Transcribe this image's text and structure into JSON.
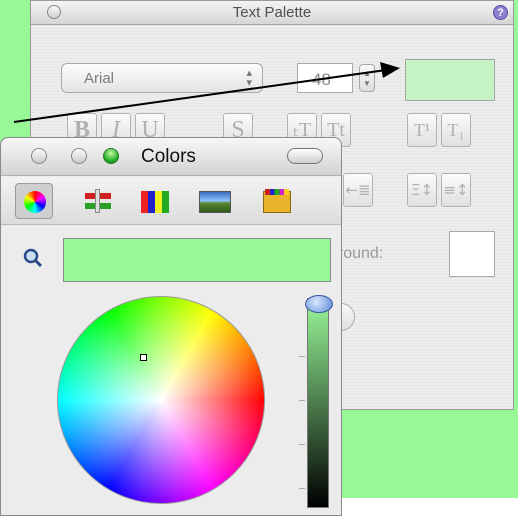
{
  "text_palette": {
    "title": "Text Palette",
    "help_glyph": "?",
    "font_name": "Arial",
    "font_size": "48",
    "background_label": "ckground:",
    "buttons": [
      "B",
      "I",
      "U",
      "S"
    ],
    "script_buttons": [
      "T¹",
      "T₁"
    ],
    "align_glyphs": [
      "←≣",
      "Ξ↕",
      "≡↕"
    ],
    "text_color_hex": "#c6f3c6"
  },
  "colors_panel": {
    "title": "Colors",
    "selected_color_hex": "#98f898",
    "tabs": [
      "color-wheel-tab",
      "sliders-tab",
      "palettes-tab",
      "image-palettes-tab",
      "crayons-tab"
    ],
    "brightness": 1.0
  },
  "colors": {
    "backdrop": "#98f898",
    "accent": "#5c86d6"
  }
}
